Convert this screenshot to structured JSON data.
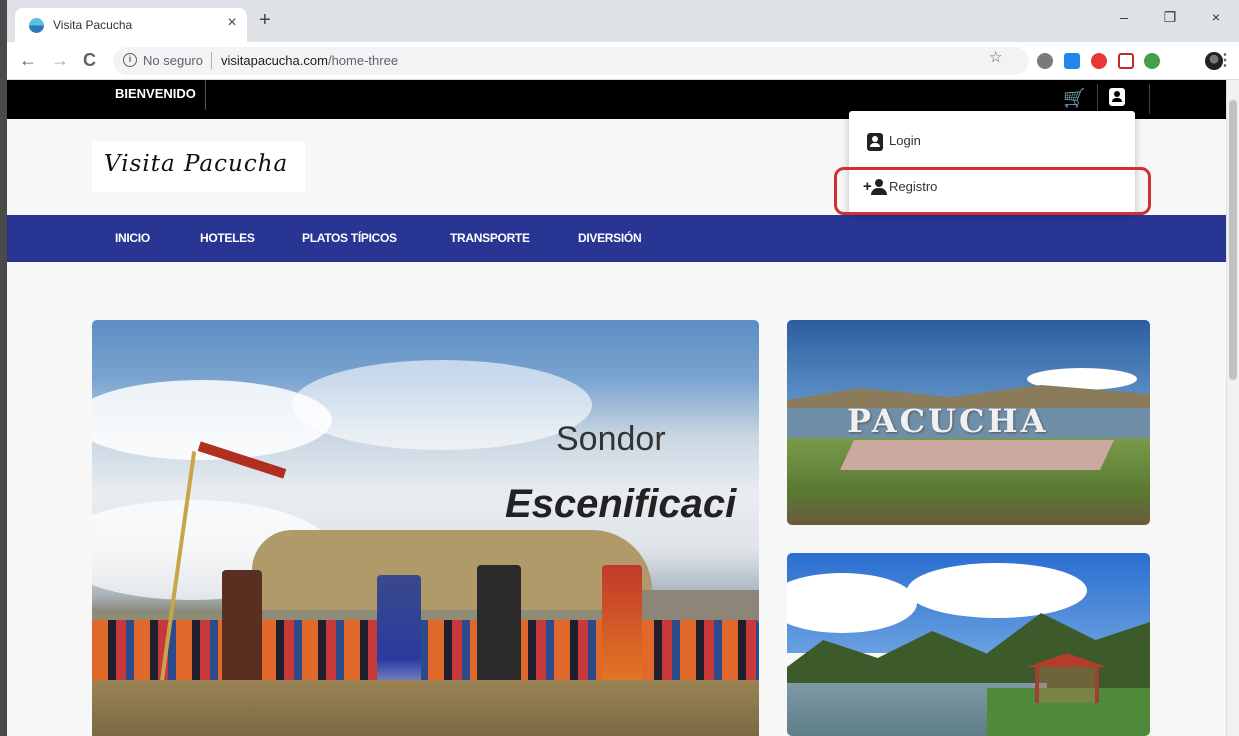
{
  "browser": {
    "tab_title": "Visita Pacucha",
    "tab_close": "×",
    "new_tab": "+",
    "back": "←",
    "forward": "→",
    "reload": "C",
    "security_label": "No seguro",
    "url_host": "visitapacucha.com",
    "url_path": "/home-three",
    "window_controls": [
      "–",
      "❐",
      "×"
    ],
    "extension_colors": [
      "#7a7a7a",
      "#1e88e5",
      "#e53935",
      "#c62828",
      "#43a047"
    ]
  },
  "site": {
    "topbar": {
      "welcome": "BIENVENIDO"
    },
    "logo_text": "Visita Pacucha",
    "nav": [
      "INICIO",
      "HOTELES",
      "PLATOS TÍPICOS",
      "TRANSPORTE",
      "DIVERSIÓN"
    ],
    "account_menu": {
      "login": "Login",
      "register": "Registro"
    },
    "hero": {
      "caption_line1": "Sondor",
      "caption_line2": "Escenificaci"
    },
    "side_cards": [
      {
        "sign": "PACUCHA"
      }
    ],
    "colors": {
      "nav_bg": "#283593",
      "topbar_bg": "#000000",
      "highlight": "#d32f2f"
    }
  }
}
